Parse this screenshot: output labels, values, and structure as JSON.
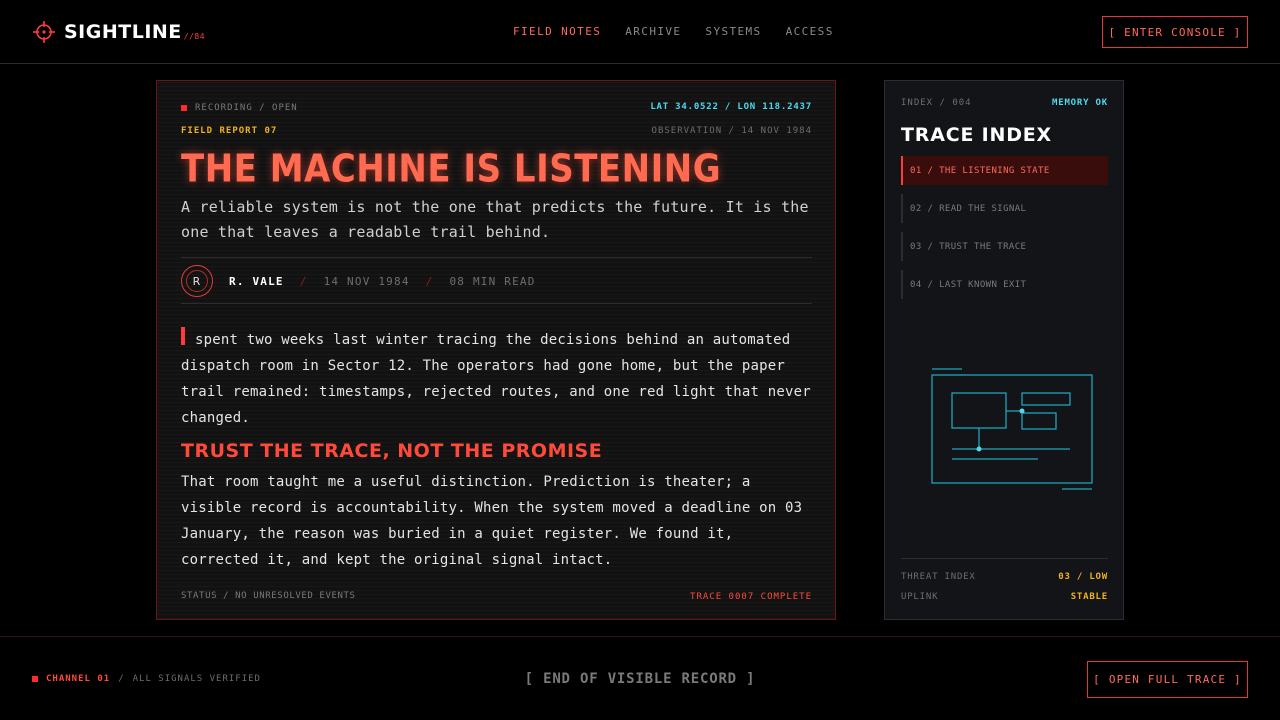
{
  "brand": {
    "name": "SIGHTLINE",
    "suffix": "//84",
    "icon": "crosshair-icon"
  },
  "nav": {
    "items": [
      {
        "label": "FIELD NOTES",
        "active": true
      },
      {
        "label": "ARCHIVE",
        "active": false
      },
      {
        "label": "SYSTEMS",
        "active": false
      },
      {
        "label": "ACCESS",
        "active": false
      }
    ],
    "console_label": "[ ENTER CONSOLE ]"
  },
  "article": {
    "recording": "RECORDING / OPEN",
    "coordinates": "LAT 34.0522 / LON 118.2437",
    "report": "FIELD REPORT 07",
    "observation": "OBSERVATION / 14 NOV 1984",
    "headline": "THE MACHINE IS LISTENING",
    "subtitle": "A reliable system is not the one that predicts the future. It is the one that leaves a readable trail behind.",
    "author_initial": "R",
    "author": "R. VALE",
    "date": "14 NOV 1984",
    "read_time": "08 MIN READ",
    "separator": "/",
    "paragraph1": "spent two weeks last winter tracing the decisions behind an automated dispatch room in Sector 12. The operators had gone home, but the paper trail remained: timestamps, rejected routes, and one red light that never changed.",
    "subheading": "TRUST THE TRACE, NOT THE PROMISE",
    "paragraph2": "That room taught me a useful distinction. Prediction is theater; a visible record is accountability. When the system moved a deadline on 03 January, the reason was buried in a quiet register. We found it, corrected it, and kept the original signal intact.",
    "status": "STATUS / NO UNRESOLVED EVENTS",
    "trace": "TRACE 0007 COMPLETE"
  },
  "side": {
    "index": "INDEX / 004",
    "memory": "MEMORY OK",
    "title": "TRACE INDEX",
    "items": [
      {
        "label": "01 / THE LISTENING STATE",
        "active": true
      },
      {
        "label": "02 / READ THE SIGNAL",
        "active": false
      },
      {
        "label": "03 / TRUST THE TRACE",
        "active": false
      },
      {
        "label": "04 / LAST KNOWN EXIT",
        "active": false
      }
    ],
    "threat_label": "THREAT INDEX",
    "threat_value": "03 / LOW",
    "uplink_label": "UPLINK",
    "uplink_value": "STABLE"
  },
  "footer": {
    "channel": "CHANNEL 01",
    "slash": "/",
    "verified": "ALL SIGNALS VERIFIED",
    "center": "[ END OF VISIBLE RECORD ]",
    "open_label": "[ OPEN FULL TRACE ]"
  },
  "colors": {
    "accent_red": "#ff3b3b",
    "headline": "#ff6a50",
    "cyan": "#4fd8ee",
    "amber": "#f2b21b",
    "background": "#000000"
  }
}
